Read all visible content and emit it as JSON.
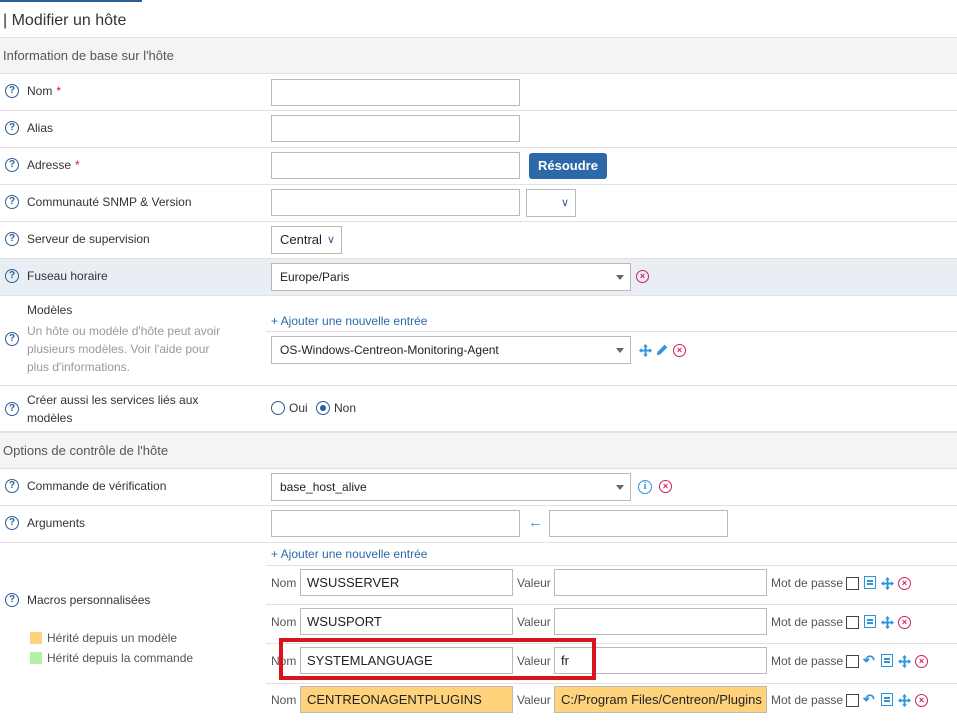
{
  "page": {
    "title": "| Modifier un hôte"
  },
  "sections": {
    "basic": "Information de base sur l'hôte",
    "control": "Options de contrôle de l'hôte"
  },
  "fields": {
    "name": {
      "label": "Nom",
      "required_mark": "*",
      "value": ""
    },
    "alias": {
      "label": "Alias",
      "value": ""
    },
    "address": {
      "label": "Adresse",
      "required_mark": "*",
      "value": "",
      "resolve_button": "Résoudre"
    },
    "snmp": {
      "label": "Communauté SNMP & Version",
      "value": "",
      "version": ""
    },
    "poller": {
      "label": "Serveur de supervision",
      "value": "Central"
    },
    "timezone": {
      "label": "Fuseau horaire",
      "value": "Europe/Paris"
    },
    "templates": {
      "label": "Modèles",
      "help": "Un hôte ou modèle d'hôte peut avoir plusieurs modèles. Voir l'aide pour plus d'informations.",
      "add_link": "+ Ajouter une nouvelle entrée",
      "value": "OS-Windows-Centreon-Monitoring-Agent"
    },
    "create_services": {
      "label": "Créer aussi les services liés aux modèles",
      "options": [
        "Oui",
        "Non"
      ],
      "selected": "Non"
    },
    "check_command": {
      "label": "Commande de vérification",
      "value": "base_host_alive"
    },
    "arguments": {
      "label": "Arguments",
      "value": "",
      "value2": ""
    },
    "macros": {
      "label": "Macros personnalisées",
      "add_link": "+ Ajouter une nouvelle entrée",
      "legend": [
        "Hérité depuis un modèle",
        "Hérité depuis la commande"
      ],
      "legend_colors": [
        "#ffd27c",
        "#b6f0a4"
      ],
      "name_label": "Nom",
      "name_label_partial": "Nom",
      "value_label": "Valeur",
      "password_label": "Mot de passe",
      "rows": [
        {
          "name": "WSUSSERVER",
          "value": ""
        },
        {
          "name": "WSUSPORT",
          "value": ""
        },
        {
          "name": "SYSTEMLANGUAGE",
          "value": "fr"
        },
        {
          "name": "CENTREONAGENTPLUGINS",
          "value": "C:/Program Files/Centreon/Plugins"
        }
      ]
    }
  }
}
